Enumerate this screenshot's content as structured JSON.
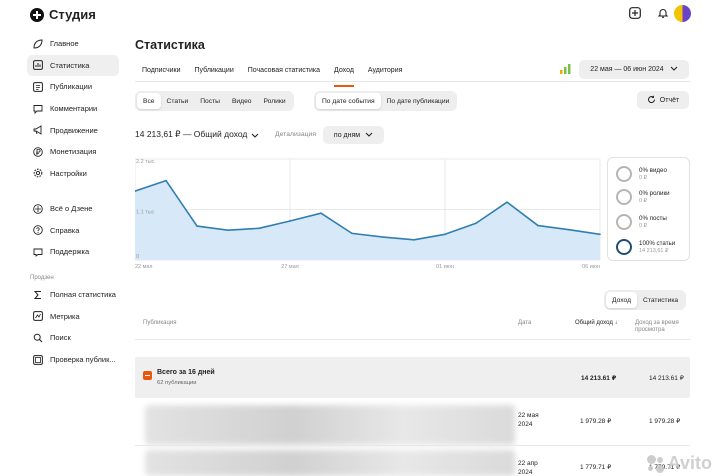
{
  "brand": {
    "name": "Студия"
  },
  "sidebar": {
    "items": [
      {
        "label": "Главное",
        "icon": "leaf-icon"
      },
      {
        "label": "Статистика",
        "icon": "stats-icon"
      },
      {
        "label": "Публикации",
        "icon": "publications-icon"
      },
      {
        "label": "Комментарии",
        "icon": "comments-icon"
      },
      {
        "label": "Продвижение",
        "icon": "megaphone-icon"
      },
      {
        "label": "Монетизация",
        "icon": "ruble-icon"
      },
      {
        "label": "Настройки",
        "icon": "gear-icon"
      }
    ],
    "items2": [
      {
        "label": "Всё о Дзене",
        "icon": "zen-icon"
      },
      {
        "label": "Справка",
        "icon": "help-icon"
      },
      {
        "label": "Поддержка",
        "icon": "support-icon"
      }
    ],
    "section_label": "Продзен",
    "items3": [
      {
        "label": "Полная статистика",
        "icon": "sigma-icon"
      },
      {
        "label": "Метрика",
        "icon": "metrika-icon"
      },
      {
        "label": "Поиск",
        "icon": "search-icon"
      },
      {
        "label": "Проверка публик...",
        "icon": "check-icon"
      }
    ]
  },
  "page": {
    "title": "Статистика"
  },
  "tabs": [
    "Подписчики",
    "Публикации",
    "Почасовая статистика",
    "Доход",
    "Аудитория"
  ],
  "active_tab": "Доход",
  "date_range": "22 мая — 06 июн 2024",
  "filters": {
    "types": [
      "Все",
      "Статьи",
      "Посты",
      "Видео",
      "Ролики"
    ],
    "dates": [
      "По дате события",
      "По дате публикации"
    ]
  },
  "report_label": "Отчёт",
  "income_label": "14 213,61 ₽ — Общий доход",
  "detail": {
    "label": "Детализация",
    "value": "по дням"
  },
  "legend": [
    {
      "pct": "0% видео",
      "amount": "0 ₽"
    },
    {
      "pct": "0% ролики",
      "amount": "0 ₽"
    },
    {
      "pct": "0% посты",
      "amount": "0 ₽"
    },
    {
      "pct": "100% статьи",
      "amount": "14 213,61 ₽"
    }
  ],
  "table_tabs": [
    "Доход",
    "Статистика"
  ],
  "table": {
    "headers": {
      "pub": "Публикация",
      "date": "Дата",
      "income": "Общий доход",
      "income_view": "Доход за время просмотра"
    },
    "total": {
      "title": "Всего за 16 дней",
      "sub": "62 публикации",
      "income": "14 213.61 ₽",
      "income_view": "14 213.61 ₽"
    },
    "rows": [
      {
        "date": "22 мая 2024",
        "income": "1 979.28 ₽",
        "income_view": "1 979.28 ₽"
      },
      {
        "date": "22 апр 2024",
        "income": "1 779.71 ₽",
        "income_view": "1 779.71 ₽"
      }
    ]
  },
  "watermark": "Avito",
  "colors": {
    "accent": "#e8590c",
    "line": "#2f7fb0",
    "area": "#d7e9f8"
  },
  "chart_data": {
    "type": "area",
    "x": [
      "22 мая",
      "23 мая",
      "24 мая",
      "25 мая",
      "26 мая",
      "27 мая",
      "28 мая",
      "29 мая",
      "30 мая",
      "31 мая",
      "01 июн",
      "02 июн",
      "03 июн",
      "04 июн",
      "05 июн",
      "06 июн"
    ],
    "values": [
      1500,
      1730,
      740,
      650,
      690,
      850,
      1020,
      580,
      500,
      440,
      560,
      800,
      1260,
      750,
      660,
      560
    ],
    "xticks": [
      "22 мая",
      "27 мая",
      "01 июн",
      "06 июн"
    ],
    "yticks": [
      "2.2 тыс",
      "1.1 тыс",
      "0"
    ],
    "ylim": [
      0,
      2200
    ],
    "grid": true
  }
}
